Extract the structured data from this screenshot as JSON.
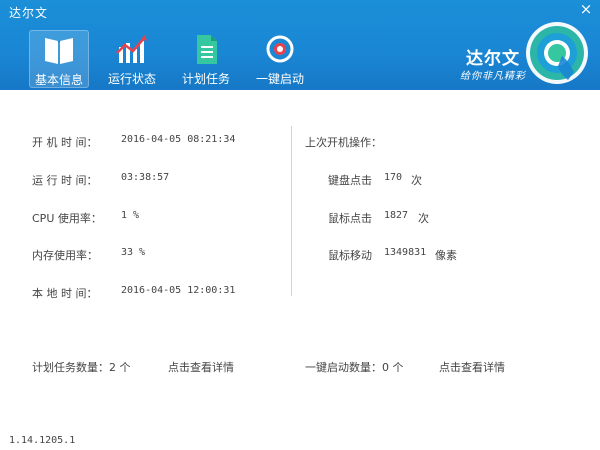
{
  "window": {
    "title": "达尔文",
    "close_glyph": "×"
  },
  "tabs": [
    {
      "label": "基本信息",
      "icon": "book-icon",
      "active": true
    },
    {
      "label": "运行状态",
      "icon": "chart-icon",
      "active": false
    },
    {
      "label": "计划任务",
      "icon": "document-icon",
      "active": false
    },
    {
      "label": "一键启动",
      "icon": "power-icon",
      "active": false
    }
  ],
  "brand": {
    "name": "达尔文",
    "slogan": "给你非凡精彩"
  },
  "info": {
    "boot_time": {
      "label": "开 机 时 间：",
      "value": "2016-04-05 08:21:34"
    },
    "run_time": {
      "label": "运 行 时 间：",
      "value": "03:38:57"
    },
    "cpu": {
      "label": "CPU  使用率：",
      "value": "1 %"
    },
    "memory": {
      "label": "内存使用率：",
      "value": "33 %"
    },
    "local_time": {
      "label": "本 地 时 间：",
      "value": "2016-04-05 12:00:31"
    }
  },
  "last_session": {
    "heading": "上次开机操作：",
    "keyboard": {
      "label": "键盘点击",
      "value": "170",
      "unit": "次"
    },
    "mouse_click": {
      "label": "鼠标点击",
      "value": "1827",
      "unit": "次"
    },
    "mouse_move": {
      "label": "鼠标移动",
      "value": "1349831",
      "unit": "像素"
    }
  },
  "footer": {
    "scheduled_label": "计划任务数量：2 个",
    "scheduled_link": "点击查看详情",
    "startup_label": "一键启动数量：0 个",
    "startup_link": "点击查看详情",
    "version": "1.14.1205.1"
  },
  "colors": {
    "header": "#1a86d4",
    "accent_green": "#35c8a0",
    "accent_red": "#e8424c"
  }
}
